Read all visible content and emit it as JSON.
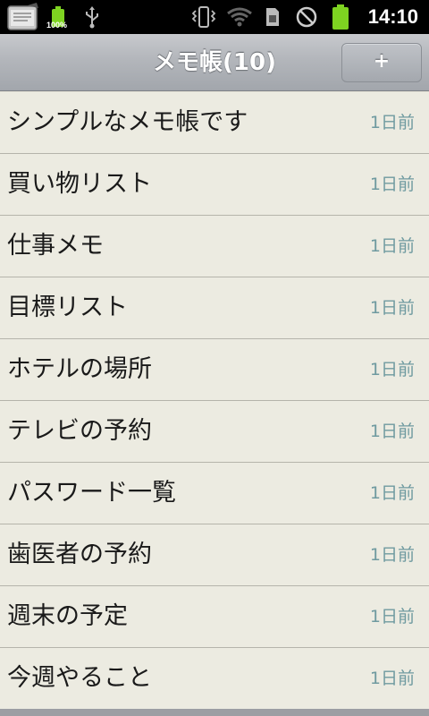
{
  "status_bar": {
    "battery_small_label": "100%",
    "time": "14:10",
    "icons": [
      "sd-card-icon",
      "battery-small-icon",
      "usb-icon",
      "vibrate-icon",
      "wifi-icon",
      "sim-icon",
      "no-signal-icon",
      "battery-icon"
    ]
  },
  "header": {
    "title": "メモ帳(10)",
    "add_label": "+"
  },
  "memos": [
    {
      "title": "シンプルなメモ帳です",
      "date": "1日前"
    },
    {
      "title": "買い物リスト",
      "date": "1日前"
    },
    {
      "title": "仕事メモ",
      "date": "1日前"
    },
    {
      "title": "目標リスト",
      "date": "1日前"
    },
    {
      "title": "ホテルの場所",
      "date": "1日前"
    },
    {
      "title": "テレビの予約",
      "date": "1日前"
    },
    {
      "title": "パスワード一覧",
      "date": "1日前"
    },
    {
      "title": "歯医者の予約",
      "date": "1日前"
    },
    {
      "title": "週末の予定",
      "date": "1日前"
    },
    {
      "title": "今週やること",
      "date": "1日前"
    }
  ],
  "colors": {
    "list_background": "#ecebe1",
    "date_text": "#6f9aa0",
    "status_bar": "#000000",
    "battery_green": "#7ed321"
  }
}
